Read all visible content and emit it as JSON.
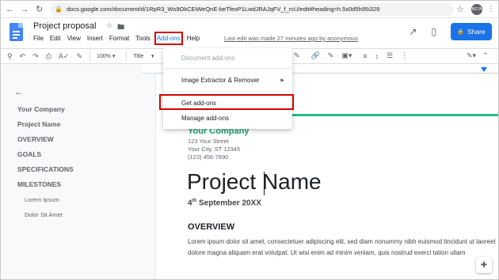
{
  "browser": {
    "url": "docs.google.com/document/d/1RpR3_Ws9OkCEiWeQnE-beTfexP1LwdJRAJqFV_f_rcU/edit#heading=h.5x0d5h95i329",
    "extension_badge": "BETA"
  },
  "header": {
    "doc_title": "Project proposal",
    "menu": [
      "File",
      "Edit",
      "View",
      "Insert",
      "Format",
      "Tools",
      "Add-ons",
      "Help"
    ],
    "last_edit": "Last edit was made 27 minutes ago by anonymous",
    "share_label": "Share"
  },
  "toolbar": {
    "zoom": "100%",
    "style": "Title"
  },
  "outline": {
    "items": [
      {
        "label": "Your Company",
        "level": 1
      },
      {
        "label": "Project Name",
        "level": 1
      },
      {
        "label": "OVERVIEW",
        "level": 1
      },
      {
        "label": "GOALS",
        "level": 1
      },
      {
        "label": "SPECIFICATIONS",
        "level": 1
      },
      {
        "label": "MILESTONES",
        "level": 1
      },
      {
        "label": "Lorem Ipsum",
        "level": 2
      },
      {
        "label": "Dolor Sit Amet",
        "level": 2
      }
    ]
  },
  "document": {
    "company": "Your Company",
    "address_lines": [
      "123 Your Street",
      "Your City, ST 12345",
      "(123) 456-7890"
    ],
    "title_before_cursor": "Project ",
    "title_after_cursor": "Name",
    "date_day": "4",
    "date_suffix": "th",
    "date_rest": " September 20XX",
    "overview_heading": "OVERVIEW",
    "overview_text": "Lorem ipsum dolor sit amet, consectetuer adipiscing elit, sed diam nonummy nibh euismod tincidunt ut laoreet dolore magna aliquam erat volutpat. Ut wisi enim ad minim veniam, quis nostrud exerci tation ullam"
  },
  "addons_menu": {
    "items": [
      {
        "label": "Document add-ons",
        "disabled": true
      },
      {
        "label": "Image Extractor & Remover",
        "disabled": false,
        "submenu": true
      },
      {
        "label": "Get add-ons",
        "disabled": false,
        "highlighted": true
      },
      {
        "label": "Manage add-ons",
        "disabled": false
      }
    ]
  },
  "colors": {
    "accent_blue": "#1a73e8",
    "highlight_red": "#d50000",
    "company_green": "#1fa67a",
    "divider_green": "#1fbd8a"
  }
}
